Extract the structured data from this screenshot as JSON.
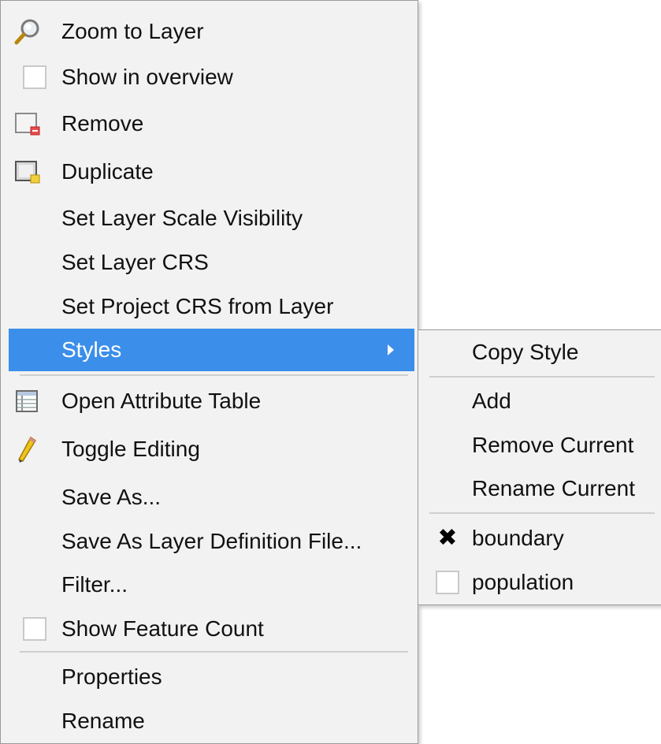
{
  "menu": {
    "items": [
      {
        "label": "Zoom to Layer",
        "icon": "magnifier-icon"
      },
      {
        "label": "Show in overview",
        "icon": "checkbox-unchecked"
      },
      {
        "label": "Remove",
        "icon": "remove-layer-icon"
      },
      {
        "label": "Duplicate",
        "icon": "duplicate-layer-icon"
      },
      {
        "label": "Set Layer Scale Visibility"
      },
      {
        "label": "Set Layer CRS"
      },
      {
        "label": "Set Project CRS from Layer"
      },
      {
        "label": "Styles",
        "has_submenu": true,
        "highlighted": true
      },
      {
        "label": "Open Attribute Table",
        "icon": "attribute-table-icon"
      },
      {
        "label": "Toggle Editing",
        "icon": "pencil-icon"
      },
      {
        "label": "Save As..."
      },
      {
        "label": "Save As Layer Definition File..."
      },
      {
        "label": "Filter..."
      },
      {
        "label": "Show Feature Count",
        "icon": "checkbox-unchecked"
      },
      {
        "label": "Properties"
      },
      {
        "label": "Rename"
      }
    ]
  },
  "submenu": {
    "items": [
      {
        "label": "Copy Style"
      },
      {
        "label": "Add"
      },
      {
        "label": "Remove Current"
      },
      {
        "label": "Rename Current"
      },
      {
        "label": "boundary",
        "checked": true
      },
      {
        "label": "population",
        "checked": false
      }
    ]
  },
  "colors": {
    "highlight": "#3b8eea",
    "menu_bg": "#f2f2f2",
    "border": "#9a9a9a"
  }
}
